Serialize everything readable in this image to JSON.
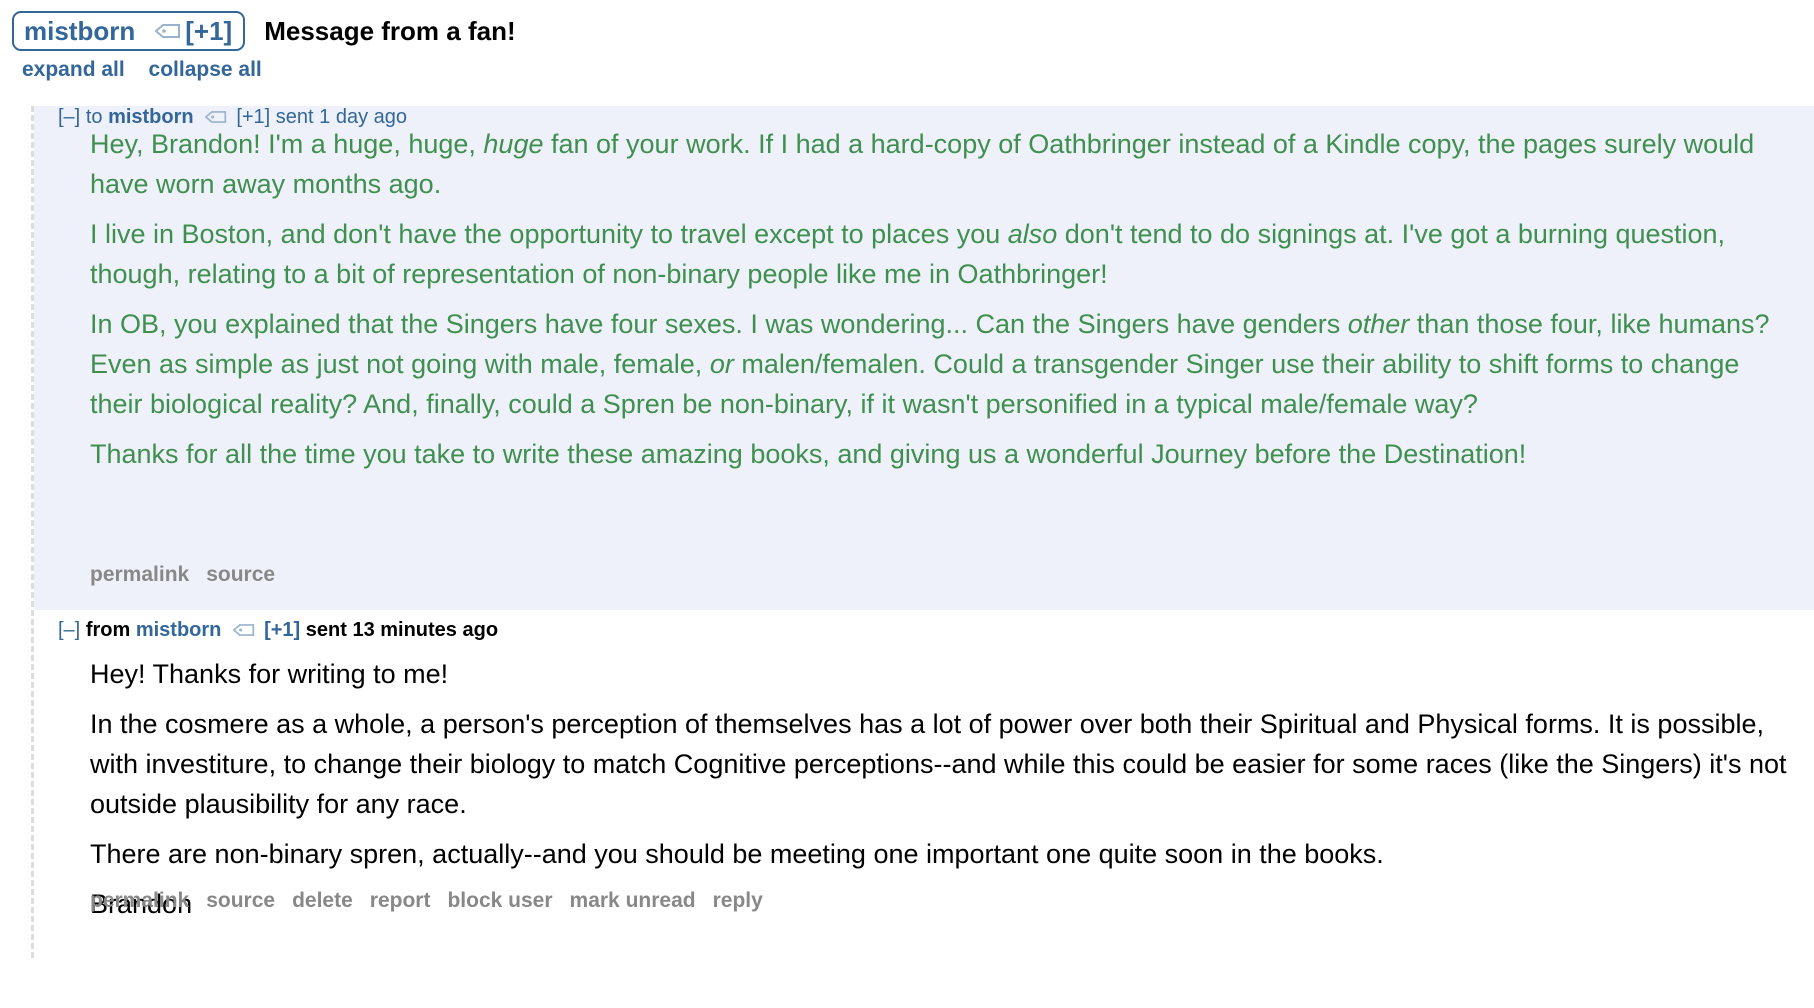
{
  "header": {
    "username": "mistborn",
    "karma_badge": "[+1]",
    "subject": "Message from a fan!"
  },
  "controls": {
    "expand_all": "expand all",
    "collapse_all": "collapse all"
  },
  "messages": [
    {
      "toggle": "[–]",
      "direction": "to",
      "user": "mistborn",
      "badge": "[+1]",
      "sent": "sent 1 day ago",
      "paragraphs": [
        [
          {
            "t": "Hey, Brandon! I'm a huge, huge, "
          },
          {
            "t": "huge",
            "em": true
          },
          {
            "t": " fan of your work. If I had a hard-copy of Oathbringer instead of a Kindle copy, the pages surely would have worn away months ago."
          }
        ],
        [
          {
            "t": "I live in Boston, and don't have the opportunity to travel except to places you "
          },
          {
            "t": "also",
            "em": true
          },
          {
            "t": " don't tend to do signings at. I've got a burning question, though, relating to a bit of representation of non-binary people like me in Oathbringer!"
          }
        ],
        [
          {
            "t": "In OB, you explained that the Singers have four sexes. I was wondering... Can the Singers have genders "
          },
          {
            "t": "other",
            "em": true
          },
          {
            "t": " than those four, like humans? Even as simple as just not going with male, female, "
          },
          {
            "t": "or",
            "em": true
          },
          {
            "t": " malen/femalen. Could a transgender Singer use their ability to shift forms to change their biological reality? And, finally, could a Spren be non-binary, if it wasn't personified in a typical male/female way?"
          }
        ],
        [
          {
            "t": "Thanks for all the time you take to write these amazing books, and giving us a wonderful Journey before the Destination!"
          }
        ]
      ],
      "actions": [
        "permalink",
        "source"
      ]
    },
    {
      "toggle": "[–]",
      "direction": "from",
      "user": "mistborn",
      "badge": "[+1]",
      "sent": "sent 13 minutes ago",
      "paragraphs": [
        [
          {
            "t": "Hey! Thanks for writing to me!"
          }
        ],
        [
          {
            "t": "In the cosmere as a whole, a person's perception of themselves has a lot of power over both their Spiritual and Physical forms. It is possible, with investiture, to change their biology to match Cognitive perceptions--and while this could be easier for some races (like the Singers) it's not outside plausibility for any race."
          }
        ],
        [
          {
            "t": "There are non-binary spren, actually--and you should be meeting one important one quite soon in the books."
          }
        ],
        [
          {
            "t": "Brandon"
          }
        ]
      ],
      "actions": [
        "permalink",
        "source",
        "delete",
        "report",
        "block user",
        "mark unread",
        "reply"
      ]
    }
  ],
  "icons": {
    "user_tag": "tag-icon",
    "collapse": "collapse-toggle"
  },
  "colors": {
    "link_blue": "#336699",
    "sent_text_green": "#3f8f4f",
    "sent_bg": "#eef1fa",
    "action_gray": "#888888"
  }
}
